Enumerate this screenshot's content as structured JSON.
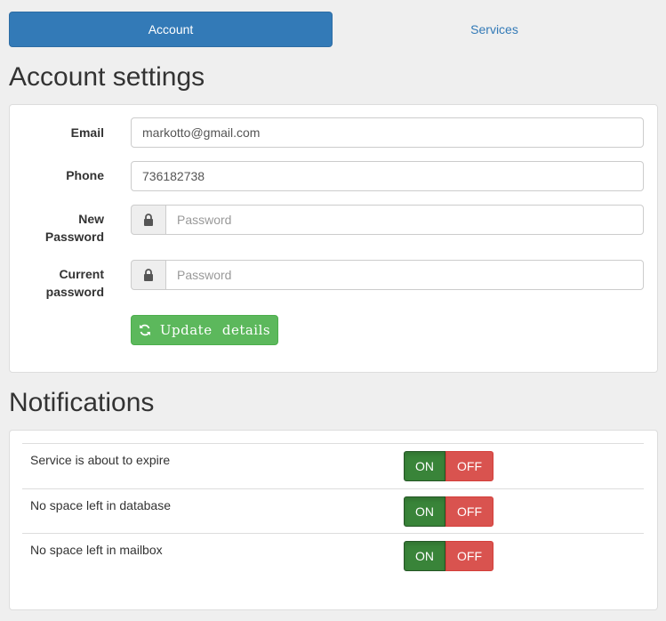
{
  "tabs": [
    {
      "label": "Account",
      "active": true
    },
    {
      "label": "Services",
      "active": false
    }
  ],
  "account": {
    "title": "Account settings",
    "email_label": "Email",
    "email_value": "markotto@gmail.com",
    "phone_label": "Phone",
    "phone_value": "736182738",
    "new_password_label_1": "New",
    "new_password_label_2": "Password",
    "new_password_placeholder": "Password",
    "current_password_label_1": "Current",
    "current_password_label_2": "password",
    "current_password_placeholder": "Password",
    "update_button": "Update details",
    "lock_icon": "lock-icon",
    "refresh_icon": "refresh-icon"
  },
  "notifications": {
    "title": "Notifications",
    "items": [
      {
        "label": "Service is about to expire",
        "on": "ON",
        "off": "OFF",
        "state": "on"
      },
      {
        "label": "No space left in database",
        "on": "ON",
        "off": "OFF",
        "state": "on"
      },
      {
        "label": "No space left in mailbox",
        "on": "ON",
        "off": "OFF",
        "state": "on"
      }
    ]
  },
  "colors": {
    "primary": "#337ab7",
    "success": "#5cb85c",
    "on_active": "#398439",
    "off": "#d9534f"
  }
}
